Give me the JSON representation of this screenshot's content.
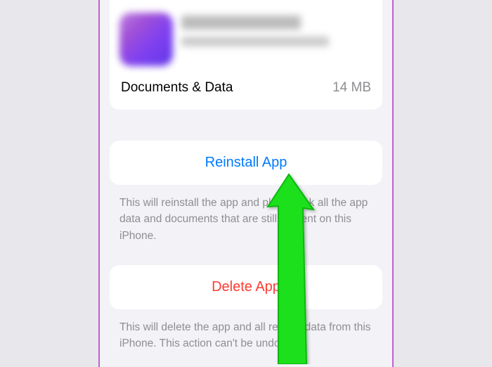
{
  "app_storage": {
    "documents_label": "Documents & Data",
    "documents_value": "14 MB"
  },
  "actions": {
    "reinstall_label": "Reinstall App",
    "reinstall_hint": "This will reinstall the app and place back all the app data and documents that are still present on this iPhone.",
    "delete_label": "Delete App",
    "delete_hint": "This will delete the app and all related data from this iPhone. This action can't be undone."
  }
}
